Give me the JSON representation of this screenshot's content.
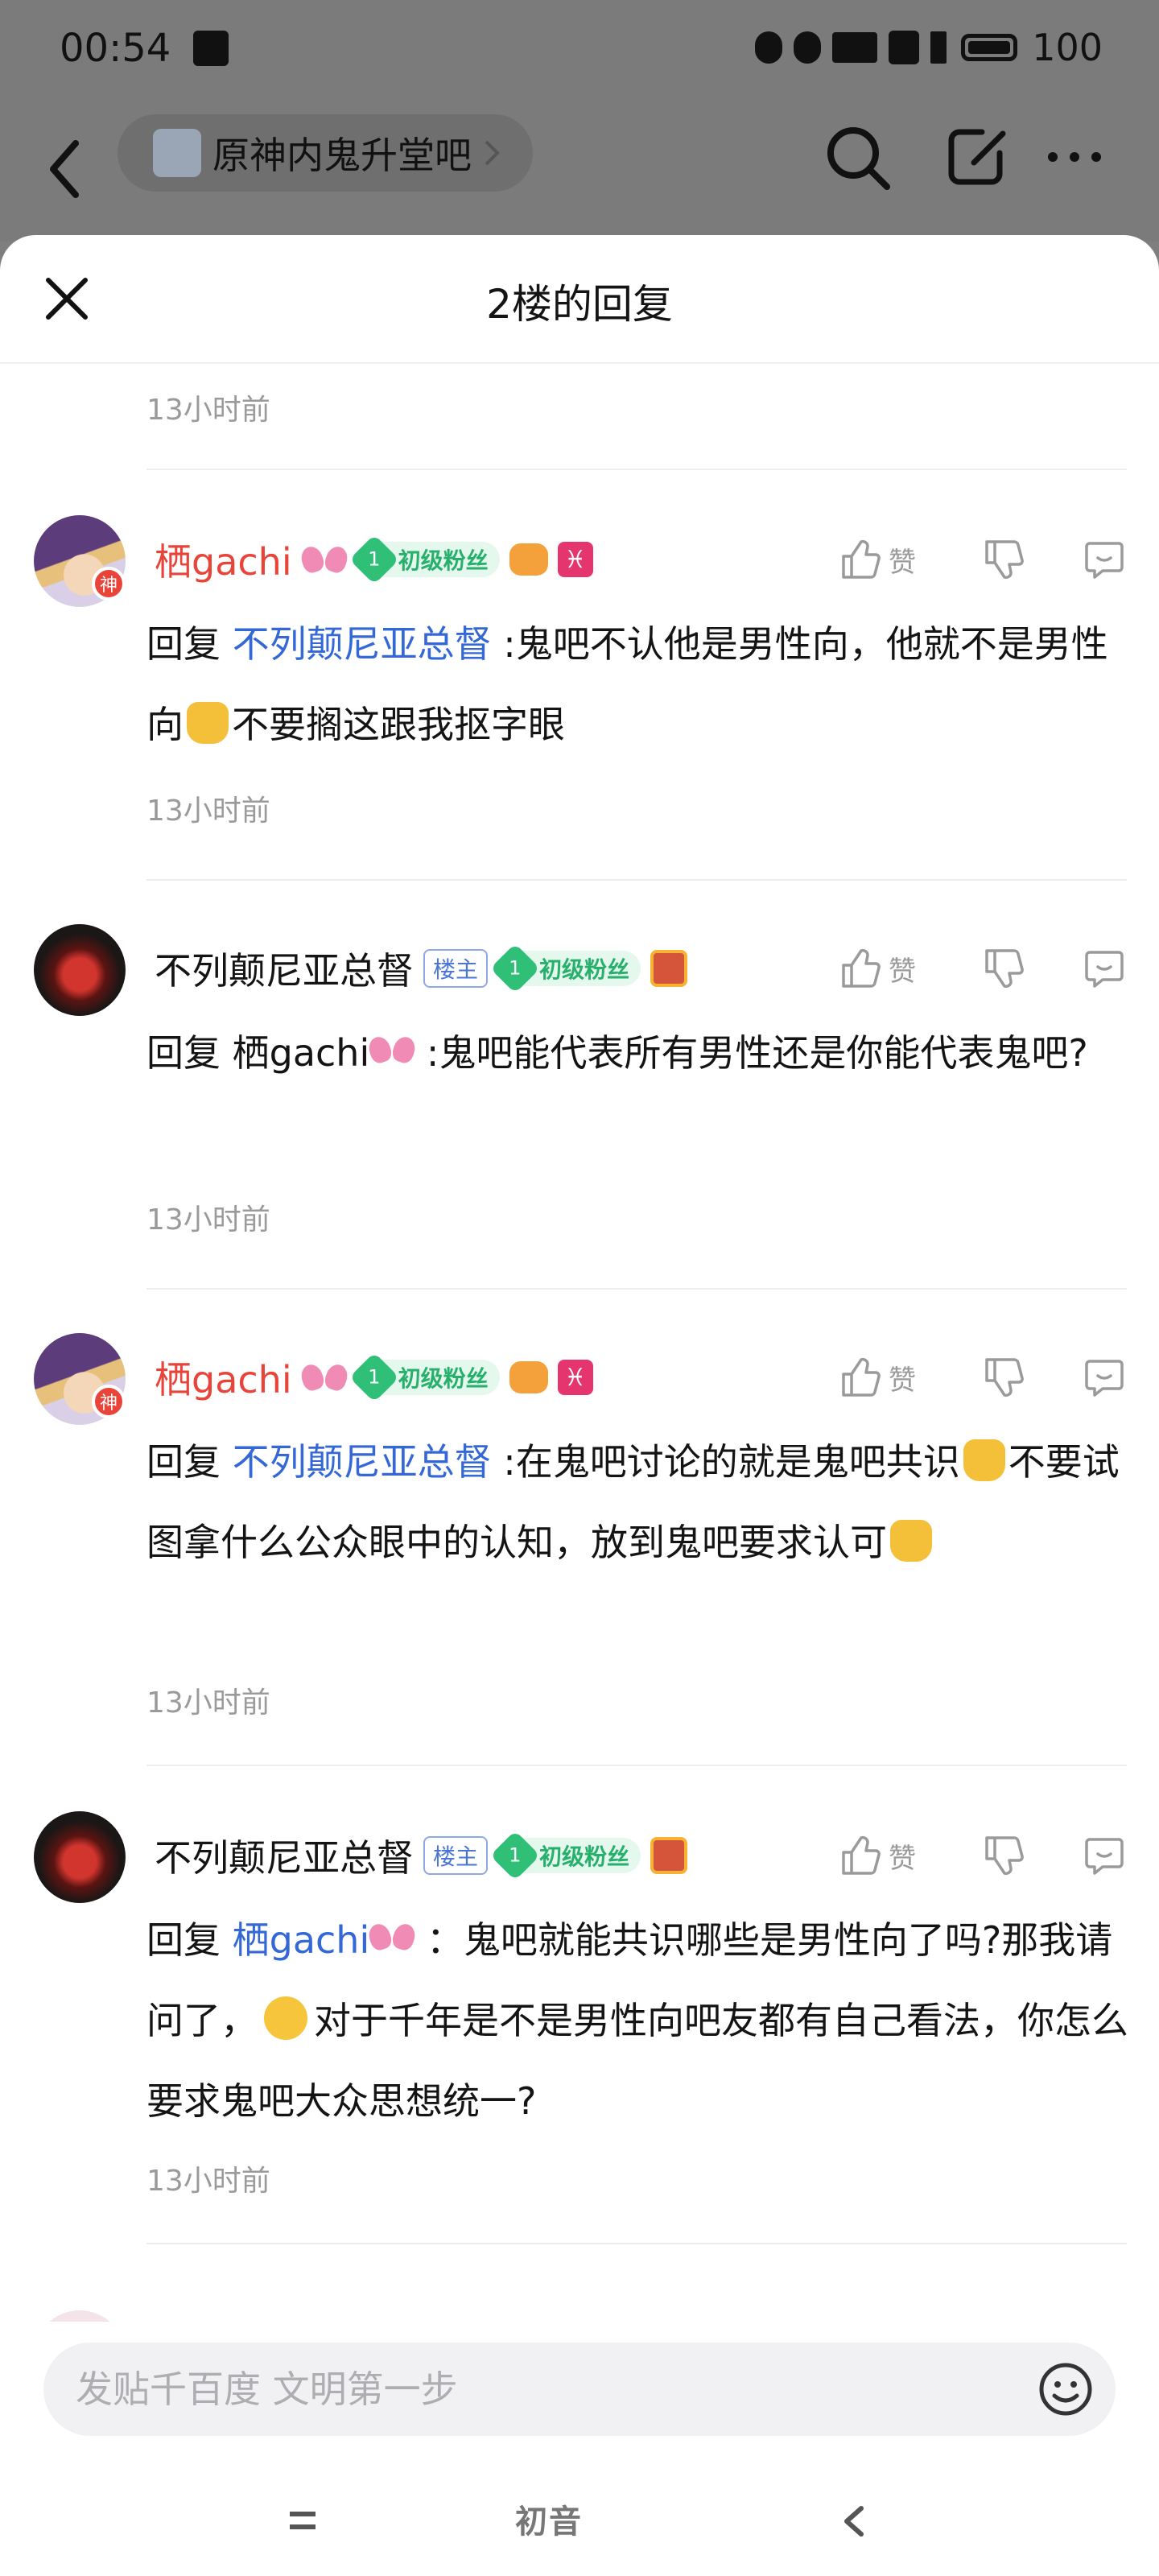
{
  "status_bar": {
    "time": "00:54",
    "battery": "100"
  },
  "nav": {
    "forum_name": "原神内鬼升堂吧"
  },
  "sheet": {
    "title": "2楼的回复",
    "top_time": "13小时前"
  },
  "action_labels": {
    "like": "赞"
  },
  "badges": {
    "fan_level": "1",
    "fan_text": "初级粉丝",
    "owner": "楼主"
  },
  "replies": [
    {
      "user": "栖gachi",
      "prefix": "回复",
      "target": "不列颠尼亚总督",
      "text": ":鬼吧不认他是男性向，他就不是男性向",
      "text_after_emoji": "不要搁这跟我抠字眼",
      "time": "13小时前"
    },
    {
      "user": "不列颠尼亚总督",
      "prefix": "回复",
      "target": "栖gachi",
      "text": ":鬼吧能代表所有男性还是你能代表鬼吧?",
      "time": "13小时前"
    },
    {
      "user": "栖gachi",
      "prefix": "回复",
      "target": "不列颠尼亚总督",
      "text": ":在鬼吧讨论的就是鬼吧共识",
      "text_after_emoji": "不要试图拿什么公众眼中的认知，放到鬼吧要求认可",
      "time": "13小时前"
    },
    {
      "user": "不列颠尼亚总督",
      "prefix": "回复",
      "target": "栖gachi",
      "text": "：鬼吧就能共识哪些是男性向了吗?那我请问了，",
      "text_after_emoji": "对于千年是不是男性向吧友都有自己看法，你怎么要求鬼吧大众思想统一?",
      "time": "13小时前"
    }
  ],
  "input": {
    "placeholder": "发贴千百度 文明第一步"
  },
  "system_nav": {
    "home_label": "初音"
  }
}
